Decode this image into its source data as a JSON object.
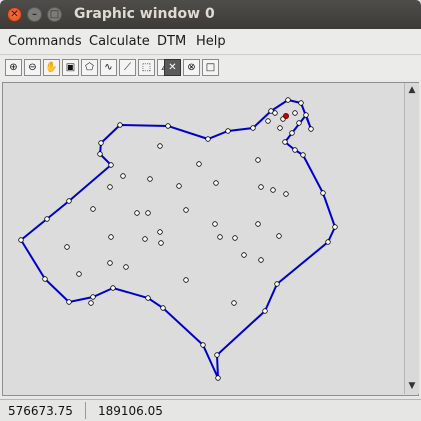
{
  "window": {
    "title": "Graphic window 0"
  },
  "titlebar_buttons": {
    "close": "✕",
    "minimize": "–",
    "maximize": "□"
  },
  "menu": [
    "Commands",
    "Calculate",
    "DTM",
    "Help"
  ],
  "toolbar": [
    "zoom-in-icon",
    "zoom-out-icon",
    "pan-hand-icon",
    "fit-view-icon",
    "polygon-select-icon",
    "contour-icon",
    "break-line-icon",
    "window-select-icon",
    "triangulate-icon",
    "select-icon",
    "polygon-icon",
    "rectangle-icon"
  ],
  "status": {
    "x": "576673.75",
    "y": "189106.05"
  },
  "colors": {
    "boundary": "#0000cc",
    "point": "#ffffff",
    "selected_point": "#cc0000",
    "canvas": "#dcdcdc"
  }
}
